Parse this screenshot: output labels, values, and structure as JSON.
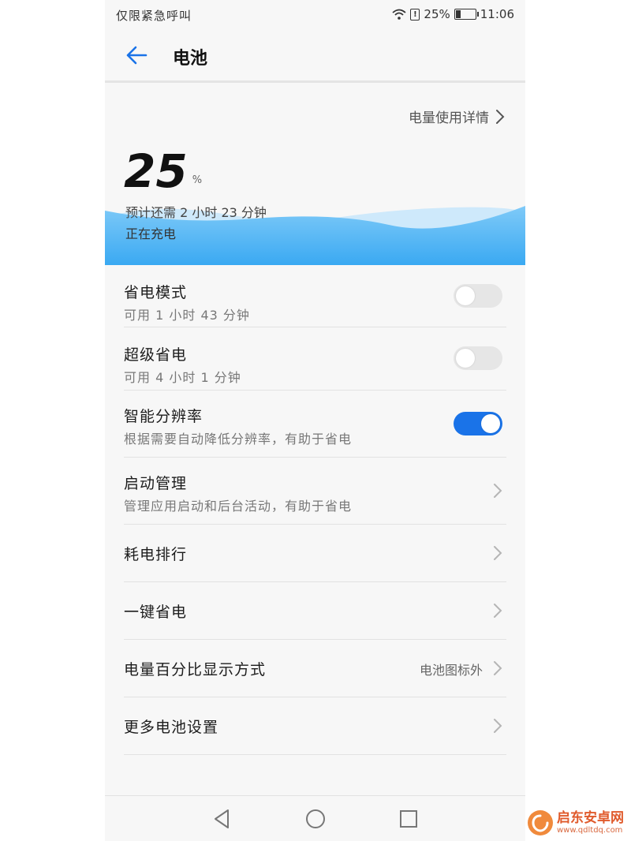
{
  "status_bar": {
    "carrier": "仅限紧急呼叫",
    "battery_text": "25%",
    "time": "11:06",
    "icons": [
      "wifi-icon",
      "alert-icon",
      "battery-charging-icon"
    ]
  },
  "header": {
    "title": "电池"
  },
  "battery": {
    "usage_details_label": "电量使用详情",
    "percent": "25",
    "percent_sign": "%",
    "remaining_time": "预计还需 2 小时 23 分钟",
    "charging_status": "正在充电",
    "level": 0.25
  },
  "list": {
    "items": [
      {
        "title": "省电模式",
        "subtitle": "可用 1 小时 43 分钟",
        "control": "toggle",
        "on": false
      },
      {
        "title": "超级省电",
        "subtitle": "可用 4 小时 1 分钟",
        "control": "toggle",
        "on": false
      },
      {
        "title": "智能分辨率",
        "subtitle": "根据需要自动降低分辨率，有助于省电",
        "control": "toggle",
        "on": true
      },
      {
        "title": "启动管理",
        "subtitle": "管理应用启动和后台活动，有助于省电",
        "control": "chevron"
      },
      {
        "title": "耗电排行",
        "control": "chevron"
      },
      {
        "title": "一键省电",
        "control": "chevron"
      },
      {
        "title": "电量百分比显示方式",
        "value": "电池图标外",
        "control": "chevron"
      },
      {
        "title": "更多电池设置",
        "control": "chevron"
      }
    ]
  },
  "nav_bar": {
    "icons": [
      "back-triangle-icon",
      "home-circle-icon",
      "recents-square-icon"
    ]
  },
  "watermark": {
    "name": "启东安卓网",
    "url": "www.qdltdq.com"
  },
  "colors": {
    "accent": "#1a73e8",
    "wave": "#4db3f5",
    "background": "#f7f7f7"
  }
}
